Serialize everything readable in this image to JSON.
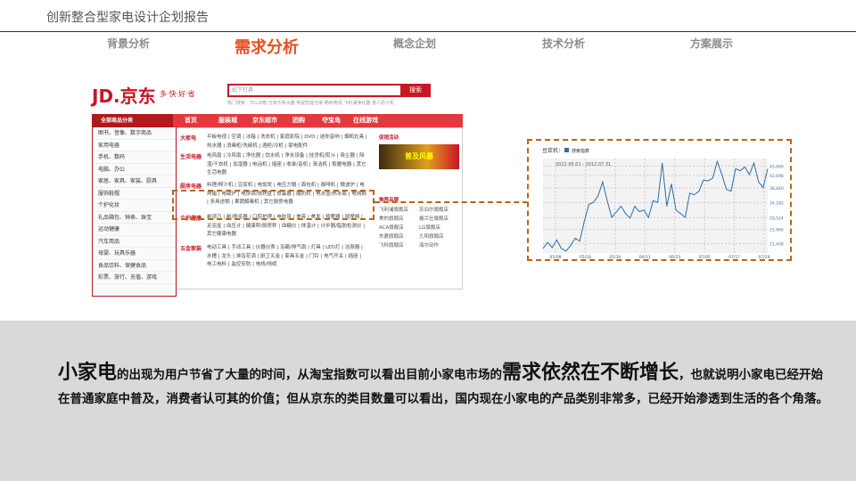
{
  "header": {
    "title": "创新整合型家电设计企划报告"
  },
  "nav": [
    {
      "label": "背景分析"
    },
    {
      "label": "需求分析",
      "active": true
    },
    {
      "label": "概念企划"
    },
    {
      "label": "技术分析"
    },
    {
      "label": "方案展示"
    }
  ],
  "jd": {
    "logo": "JD.京东",
    "slogan": "多·快·好·省",
    "search_value": "松下灯具",
    "search_button": "搜索",
    "hot": "热门搜索：TCL冰箱  万家乐热水器  电视智能当家  畅响电视  飞利浦净化器  惠人原汁机",
    "all_categories": "全部商品分类",
    "menu": [
      "首页",
      "服装城",
      "京东超市",
      "团购",
      "夺宝岛",
      "在线游戏"
    ],
    "categories": [
      "图书、音像、数字商品",
      "家用电器",
      "手机、数码",
      "电脑、办公",
      "家居、家具、家装、厨具",
      "服饰鞋帽",
      "个护化妆",
      "礼品箱包、钟表、珠宝",
      "运动健康",
      "汽车用品",
      "母婴、玩具乐器",
      "食品饮料、保健食品",
      "彩票、旅行、充值、游戏"
    ],
    "groups": [
      {
        "title": "大家电",
        "items": "平板电视 | 空调 | 冰箱 | 洗衣机 | 家庭影院 | DVD | 迷你音响 | 烟机灶具 | 热水器 | 消毒柜/洗碗机 | 酒柜/冷柜 | 家电配件"
      },
      {
        "title": "生活电器",
        "items": "电风扇 | 冷风扇 | 净化器 | 饮水机 | 净水设备 | 挂烫机/熨斗 | 吸尘器 | 除湿/干衣机 | 加湿器 | 电话机 | 插座 | 收录/音机 | 清洁机 | 取暖电器 | 其它生活电器"
      },
      {
        "title": "厨房电器",
        "items": "料理/榨汁机 | 豆浆机 | 电饭煲 | 电压力锅 | 面包机 | 咖啡机 | 微波炉 | 电烤箱 | 电磁炉 | 电饼铛/烧烤盘 | 煮蛋器 | 酸奶机 | 电水壶/热水瓶 | 电炖锅 | 多用途锅 | 果蔬解毒机 | 其它厨房电器"
      },
      {
        "title": "个护健康",
        "items": "剃须刀 | 剃/脱毛器 | 口腔护理 | 电吹风 | 美容 | 美发 | 按摩器 | 按摩椅 | 足浴盆 | 血压计 | 健康秤/厨房秤 | 血糖仪 | 体温计 | 计步器/脂肪检测仪 | 其它健康电器"
      },
      {
        "title": "五金家装",
        "items": "电动工具 | 手动工具 | 仪器仪表 | 浴霸/排气扇 | 灯具 | LED灯 | 洁身器 | 水槽 | 龙头 | 淋浴花洒 | 厨卫五金 | 家具五金 | 门铃 | 电气开关 | 插座 | 电工电料 | 监控安防 | 电线/线缆"
      }
    ],
    "promo_title": "促销活动",
    "banner": "普及风暴",
    "brands_title": "推荐品牌",
    "brands": [
      "飞利浦旗舰店",
      "苏泊尔旗舰店",
      "美的旗舰店",
      "格兰仕旗舰店",
      "ACA旗舰店",
      "LG旗舰店",
      "东菱旗舰店",
      "九阳旗舰店",
      "飞科旗舰店",
      "海尔动作"
    ]
  },
  "chart_data": {
    "type": "line",
    "title": "豆浆机：",
    "legend": [
      "搜索指数"
    ],
    "subtitle": "2012.05.01 - 2012.07.31",
    "x_ticks": [
      "05/08",
      "05/18",
      "05/30",
      "06/11",
      "06/23",
      "07/05",
      "07/17",
      "07/29"
    ],
    "y_ticks": [
      "45,666",
      "42,698",
      "38,840",
      "34,182",
      "29,524",
      "25,866",
      "21,408"
    ],
    "ylim": [
      18500,
      48000
    ],
    "series": [
      {
        "name": "搜索指数",
        "color": "#2a6faa",
        "values": [
          19900,
          21800,
          20200,
          22600,
          19900,
          19100,
          20800,
          23100,
          22200,
          28400,
          33700,
          34300,
          36300,
          40700,
          34800,
          29600,
          31400,
          33100,
          30800,
          29400,
          33100,
          31400,
          31900,
          29600,
          34800,
          34300,
          46600,
          33100,
          40100,
          31900,
          30800,
          29600,
          37200,
          36700,
          37800,
          41300,
          41000,
          41900,
          47100,
          43000,
          38400,
          37800,
          44800,
          44200,
          45400,
          43000,
          46600,
          40700,
          38900,
          44800
        ]
      }
    ]
  },
  "body": {
    "s1": "小家电",
    "s2": "的出现为用户节省了大量的时间，从淘宝指数可以看出目前小家电市场的",
    "s3": "需求依然在不断增长",
    "s4": "，也就说明小家电已经开始在普通家庭中普及，消费者认可其的价值；但从京东的类目数量可以看出，国内现在小家电的产品类别非常多，已经开始渗透到生活的各个角落。"
  }
}
